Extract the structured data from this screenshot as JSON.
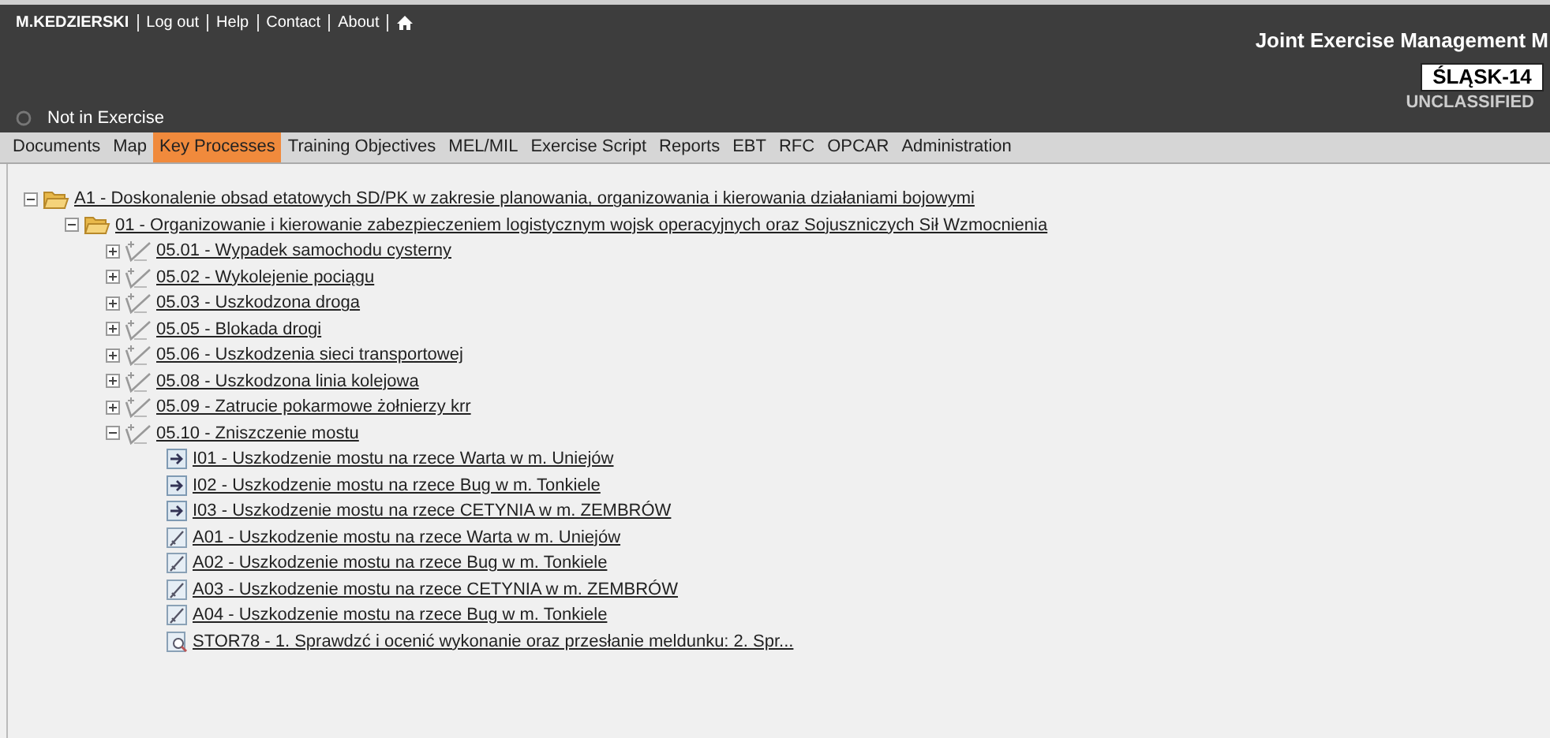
{
  "header": {
    "user": "M.KEDZIERSKI",
    "links": [
      "Log out",
      "Help",
      "Contact",
      "About"
    ],
    "status": "Not in Exercise",
    "title": "Joint Exercise Management M",
    "exercise": "ŚLĄSK-14",
    "classification": "UNCLASSIFIED"
  },
  "nav": [
    {
      "label": "Documents",
      "selected": false
    },
    {
      "label": "Map",
      "selected": false
    },
    {
      "label": "Key Processes",
      "selected": true
    },
    {
      "label": "Training Objectives",
      "selected": false
    },
    {
      "label": "MEL/MIL",
      "selected": false
    },
    {
      "label": "Exercise Script",
      "selected": false
    },
    {
      "label": "Reports",
      "selected": false
    },
    {
      "label": "EBT",
      "selected": false
    },
    {
      "label": "RFC",
      "selected": false
    },
    {
      "label": "OPCAR",
      "selected": false
    },
    {
      "label": "Administration",
      "selected": false
    }
  ],
  "tree": [
    {
      "kind": "folder",
      "label": "A1 - Doskonalenie obsad etatowych SD/PK w zakresie planowania, organizowania i kierowania działaniami bojowymi",
      "expanded": true,
      "children": [
        {
          "kind": "folder",
          "label": "01 - Organizowanie i kierowanie zabezpieczeniem logistycznym wojsk operacyjnych oraz Sojuszniczych Sił Wzmocnienia",
          "expanded": true,
          "children": [
            {
              "kind": "process",
              "label": "05.01 - Wypadek samochodu cysterny",
              "expanded": false
            },
            {
              "kind": "process",
              "label": "05.02 - Wykolejenie pociągu",
              "expanded": false
            },
            {
              "kind": "process",
              "label": "05.03 - Uszkodzona droga",
              "expanded": false
            },
            {
              "kind": "process",
              "label": "05.05 - Blokada drogi",
              "expanded": false
            },
            {
              "kind": "process",
              "label": "05.06 - Uszkodzenia sieci transportowej",
              "expanded": false
            },
            {
              "kind": "process",
              "label": "05.08 - Uszkodzona linia kolejowa",
              "expanded": false
            },
            {
              "kind": "process",
              "label": "05.09 - Zatrucie pokarmowe żołnierzy krr",
              "expanded": false
            },
            {
              "kind": "process",
              "label": "05.10 - Zniszczenie mostu",
              "expanded": true,
              "children": [
                {
                  "kind": "inject",
                  "label": "I01 - Uszkodzenie mostu na rzece Warta w m. Uniejów"
                },
                {
                  "kind": "inject",
                  "label": "I02 - Uszkodzenie mostu na rzece Bug w m. Tonkiele"
                },
                {
                  "kind": "inject",
                  "label": "I03 - Uszkodzenie mostu na rzece CETYNIA w m. ZEMBRÓW"
                },
                {
                  "kind": "action",
                  "label": "A01 - Uszkodzenie mostu na rzece Warta w m. Uniejów"
                },
                {
                  "kind": "action",
                  "label": "A02 - Uszkodzenie mostu na rzece Bug w m. Tonkiele"
                },
                {
                  "kind": "action",
                  "label": "A03 - Uszkodzenie mostu na rzece CETYNIA w m. ZEMBRÓW"
                },
                {
                  "kind": "action",
                  "label": "A04 - Uszkodzenie mostu na rzece Bug w m. Tonkiele"
                },
                {
                  "kind": "story",
                  "label": "STOR78 - 1. Sprawdzć i ocenić wykonanie oraz przesłanie meldunku: 2. Spr..."
                }
              ]
            }
          ]
        }
      ]
    }
  ]
}
